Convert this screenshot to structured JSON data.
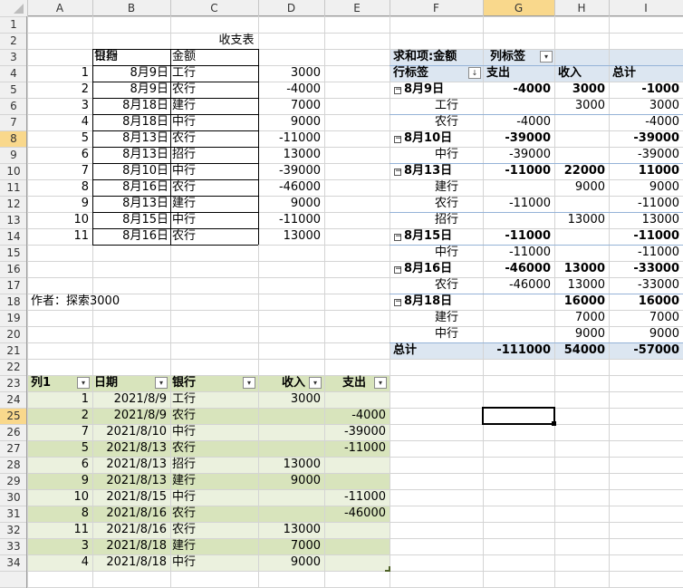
{
  "columns": [
    "A",
    "B",
    "C",
    "D",
    "E",
    "F",
    "G",
    "H",
    "I"
  ],
  "rows": [
    "1",
    "2",
    "3",
    "4",
    "5",
    "6",
    "7",
    "8",
    "9",
    "10",
    "11",
    "12",
    "13",
    "14",
    "15",
    "16",
    "17",
    "18",
    "19",
    "20",
    "21",
    "22",
    "23",
    "24",
    "25",
    "26",
    "27",
    "28",
    "29",
    "30",
    "31",
    "32",
    "33",
    "34"
  ],
  "title": "收支表",
  "source_table": {
    "headers": [
      "日期",
      "银行",
      "金额"
    ],
    "rows": [
      [
        "1",
        "8月9日",
        "工行",
        "3000"
      ],
      [
        "2",
        "8月9日",
        "农行",
        "-4000"
      ],
      [
        "3",
        "8月18日",
        "建行",
        "7000"
      ],
      [
        "4",
        "8月18日",
        "中行",
        "9000"
      ],
      [
        "5",
        "8月13日",
        "农行",
        "-11000"
      ],
      [
        "6",
        "8月13日",
        "招行",
        "13000"
      ],
      [
        "7",
        "8月10日",
        "中行",
        "-39000"
      ],
      [
        "8",
        "8月16日",
        "农行",
        "-46000"
      ],
      [
        "9",
        "8月13日",
        "建行",
        "9000"
      ],
      [
        "10",
        "8月15日",
        "中行",
        "-11000"
      ],
      [
        "11",
        "8月16日",
        "农行",
        "13000"
      ]
    ]
  },
  "author": "作者：探索3000",
  "pivot": {
    "corner_label": "求和项:金额",
    "col_label": "列标签",
    "row_label": "行标签",
    "col_headers": [
      "支出",
      "收入",
      "总计"
    ],
    "rows": [
      {
        "label": "8月9日",
        "group": true,
        "v": [
          "-4000",
          "3000",
          "-1000"
        ]
      },
      {
        "label": "工行",
        "group": false,
        "v": [
          "",
          "3000",
          "3000"
        ]
      },
      {
        "label": "农行",
        "group": false,
        "v": [
          "-4000",
          "",
          "-4000"
        ]
      },
      {
        "label": "8月10日",
        "group": true,
        "v": [
          "-39000",
          "",
          "-39000"
        ]
      },
      {
        "label": "中行",
        "group": false,
        "v": [
          "-39000",
          "",
          "-39000"
        ]
      },
      {
        "label": "8月13日",
        "group": true,
        "v": [
          "-11000",
          "22000",
          "11000"
        ]
      },
      {
        "label": "建行",
        "group": false,
        "v": [
          "",
          "9000",
          "9000"
        ]
      },
      {
        "label": "农行",
        "group": false,
        "v": [
          "-11000",
          "",
          "-11000"
        ]
      },
      {
        "label": "招行",
        "group": false,
        "v": [
          "",
          "13000",
          "13000"
        ]
      },
      {
        "label": "8月15日",
        "group": true,
        "v": [
          "-11000",
          "",
          "-11000"
        ]
      },
      {
        "label": "中行",
        "group": false,
        "v": [
          "-11000",
          "",
          "-11000"
        ]
      },
      {
        "label": "8月16日",
        "group": true,
        "v": [
          "-46000",
          "13000",
          "-33000"
        ]
      },
      {
        "label": "农行",
        "group": false,
        "v": [
          "-46000",
          "13000",
          "-33000"
        ]
      },
      {
        "label": "8月18日",
        "group": true,
        "v": [
          "",
          "16000",
          "16000"
        ]
      },
      {
        "label": "建行",
        "group": false,
        "v": [
          "",
          "7000",
          "7000"
        ]
      },
      {
        "label": "中行",
        "group": false,
        "v": [
          "",
          "9000",
          "9000"
        ]
      }
    ],
    "total": {
      "label": "总计",
      "v": [
        "-111000",
        "54000",
        "-57000"
      ]
    }
  },
  "table2": {
    "headers": [
      "列1",
      "日期",
      "银行",
      "收入",
      "支出"
    ],
    "rows": [
      [
        "1",
        "2021/8/9",
        "工行",
        "3000",
        ""
      ],
      [
        "2",
        "2021/8/9",
        "农行",
        "",
        "-4000"
      ],
      [
        "7",
        "2021/8/10",
        "中行",
        "",
        "-39000"
      ],
      [
        "5",
        "2021/8/13",
        "农行",
        "",
        "-11000"
      ],
      [
        "6",
        "2021/8/13",
        "招行",
        "13000",
        ""
      ],
      [
        "9",
        "2021/8/13",
        "建行",
        "9000",
        ""
      ],
      [
        "10",
        "2021/8/15",
        "中行",
        "",
        "-11000"
      ],
      [
        "8",
        "2021/8/16",
        "农行",
        "",
        "-46000"
      ],
      [
        "11",
        "2021/8/16",
        "农行",
        "13000",
        ""
      ],
      [
        "3",
        "2021/8/18",
        "建行",
        "7000",
        ""
      ],
      [
        "4",
        "2021/8/18",
        "中行",
        "9000",
        ""
      ]
    ]
  },
  "colors": {
    "header_bg": "#f0f0f0",
    "selected_header_bg": "#f9d88c",
    "pivot_bg": "#dce6f1",
    "table_dark": "#d8e4bc",
    "table_light": "#ebf1de",
    "gridline": "#d4d4d4"
  }
}
